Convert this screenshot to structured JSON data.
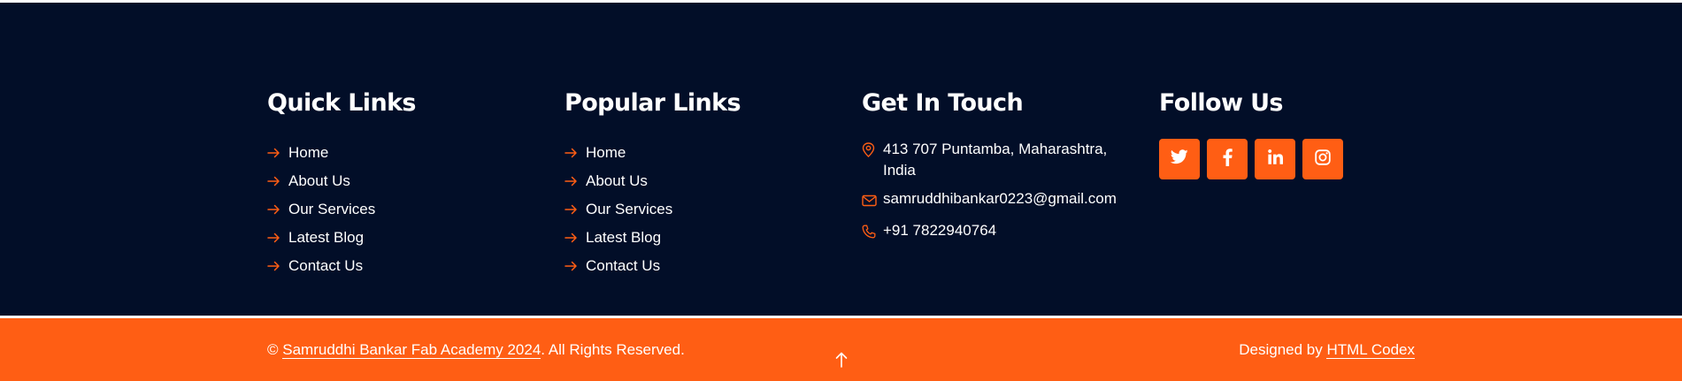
{
  "colors": {
    "footer_bg": "#020e28",
    "accent": "#ff5e14",
    "text": "#ffffff"
  },
  "quick_links": {
    "title": "Quick Links",
    "items": [
      {
        "label": "Home"
      },
      {
        "label": "About Us"
      },
      {
        "label": "Our Services"
      },
      {
        "label": "Latest Blog"
      },
      {
        "label": "Contact Us"
      }
    ]
  },
  "popular_links": {
    "title": "Popular Links",
    "items": [
      {
        "label": "Home"
      },
      {
        "label": "About Us"
      },
      {
        "label": "Our Services"
      },
      {
        "label": "Latest Blog"
      },
      {
        "label": "Contact Us"
      }
    ]
  },
  "get_in_touch": {
    "title": "Get In Touch",
    "address": "413 707 Puntamba, Maharashtra, India",
    "email": "samruddhibankar0223@gmail.com",
    "phone": "+91 7822940764",
    "icons": [
      "location-pin-icon",
      "envelope-icon",
      "phone-icon"
    ]
  },
  "follow_us": {
    "title": "Follow Us",
    "socials": [
      "twitter-icon",
      "facebook-icon",
      "linkedin-icon",
      "instagram-icon"
    ]
  },
  "bottom_bar": {
    "copyright_symbol": "©",
    "site_name": "Samruddhi Bankar Fab Academy 2024",
    "rights": ". All Rights Reserved.",
    "designed_by_prefix": "Designed by",
    "designer": "HTML Codex",
    "back_to_top_icon": "arrow-up-icon"
  }
}
